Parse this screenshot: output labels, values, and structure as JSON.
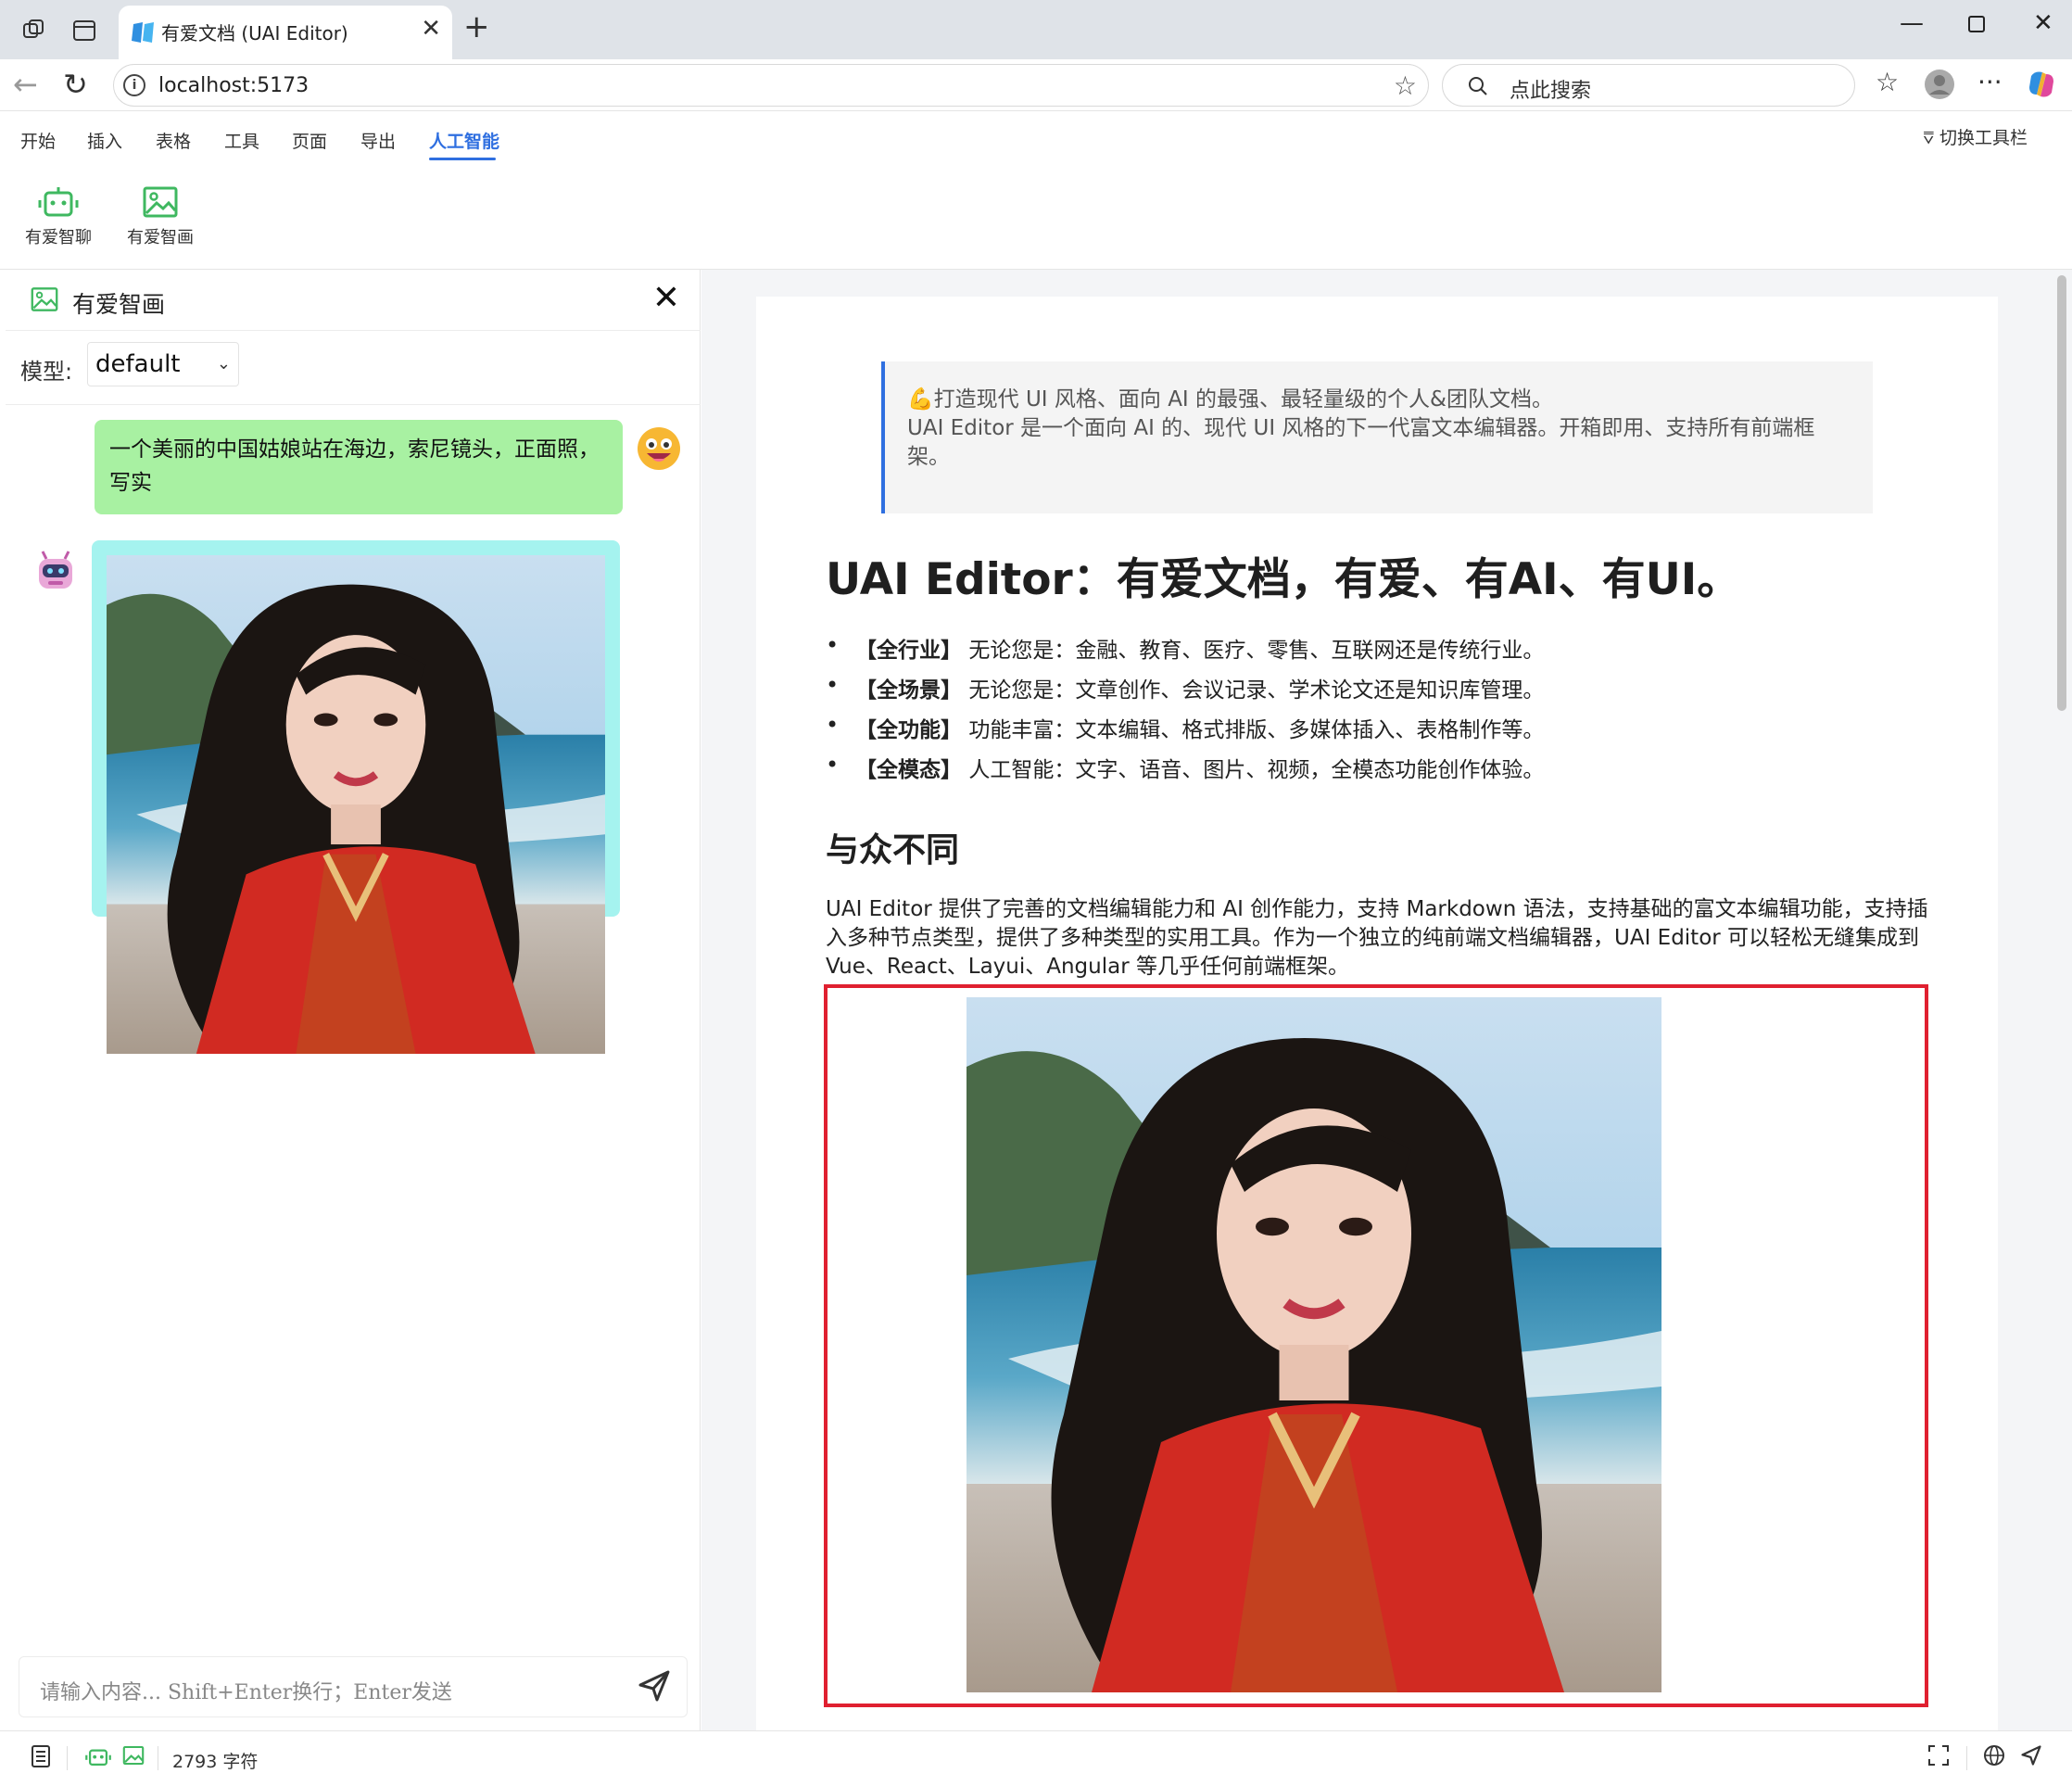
{
  "browser": {
    "tab_title": "有爱文档 (UAI Editor)",
    "url": "localhost:5173",
    "search_placeholder": "点此搜索"
  },
  "toolbar": {
    "tabs": [
      "开始",
      "插入",
      "表格",
      "工具",
      "页面",
      "导出",
      "人工智能"
    ],
    "active_tab": "人工智能",
    "toggle_label": "切换工具栏",
    "buttons": [
      {
        "label": "有爱智聊",
        "icon": "robot-icon"
      },
      {
        "label": "有爱智画",
        "icon": "image-icon"
      }
    ]
  },
  "panel": {
    "title": "有爱智画",
    "model_label": "模型:",
    "model_value": "default",
    "user_message": "一个美丽的中国姑娘站在海边，索尼镜头，正面照，写实",
    "input_placeholder": "请输入内容... Shift+Enter换行；Enter发送"
  },
  "document": {
    "quote_line1": "💪打造现代 UI 风格、面向 AI 的最强、最轻量级的个人&团队文档。",
    "quote_line2": "UAI Editor 是一个面向 AI 的、现代 UI 风格的下一代富文本编辑器。开箱即用、支持所有前端框架。",
    "title": "UAI Editor：有爱文档，有爱、有AI、有UI。",
    "features": [
      {
        "tag": "【全行业】",
        "text": "无论您是：金融、教育、医疗、零售、互联网还是传统行业。"
      },
      {
        "tag": "【全场景】",
        "text": "无论您是：文章创作、会议记录、学术论文还是知识库管理。"
      },
      {
        "tag": "【全功能】",
        "text": "功能丰富：文本编辑、格式排版、多媒体插入、表格制作等。"
      },
      {
        "tag": "【全模态】",
        "text": "人工智能：文字、语音、图片、视频，全模态功能创作体验。"
      }
    ],
    "heading2": "与众不同",
    "paragraph": "UAI Editor 提供了完善的文档编辑能力和 AI 创作能力，支持 Markdown 语法，支持基础的富文本编辑功能，支持插入多种节点类型，提供了多种类型的实用工具。作为一个独立的纯前端文档编辑器，UAI Editor 可以轻松无缝集成到 Vue、React、Layui、Angular 等几乎任何前端框架。"
  },
  "status": {
    "char_count": "2793 字符"
  },
  "colors": {
    "accent": "#2f6fe0",
    "user_bubble": "#a8f1a2",
    "bot_bubble": "#a5f3ef",
    "image_highlight": "#e02030"
  }
}
